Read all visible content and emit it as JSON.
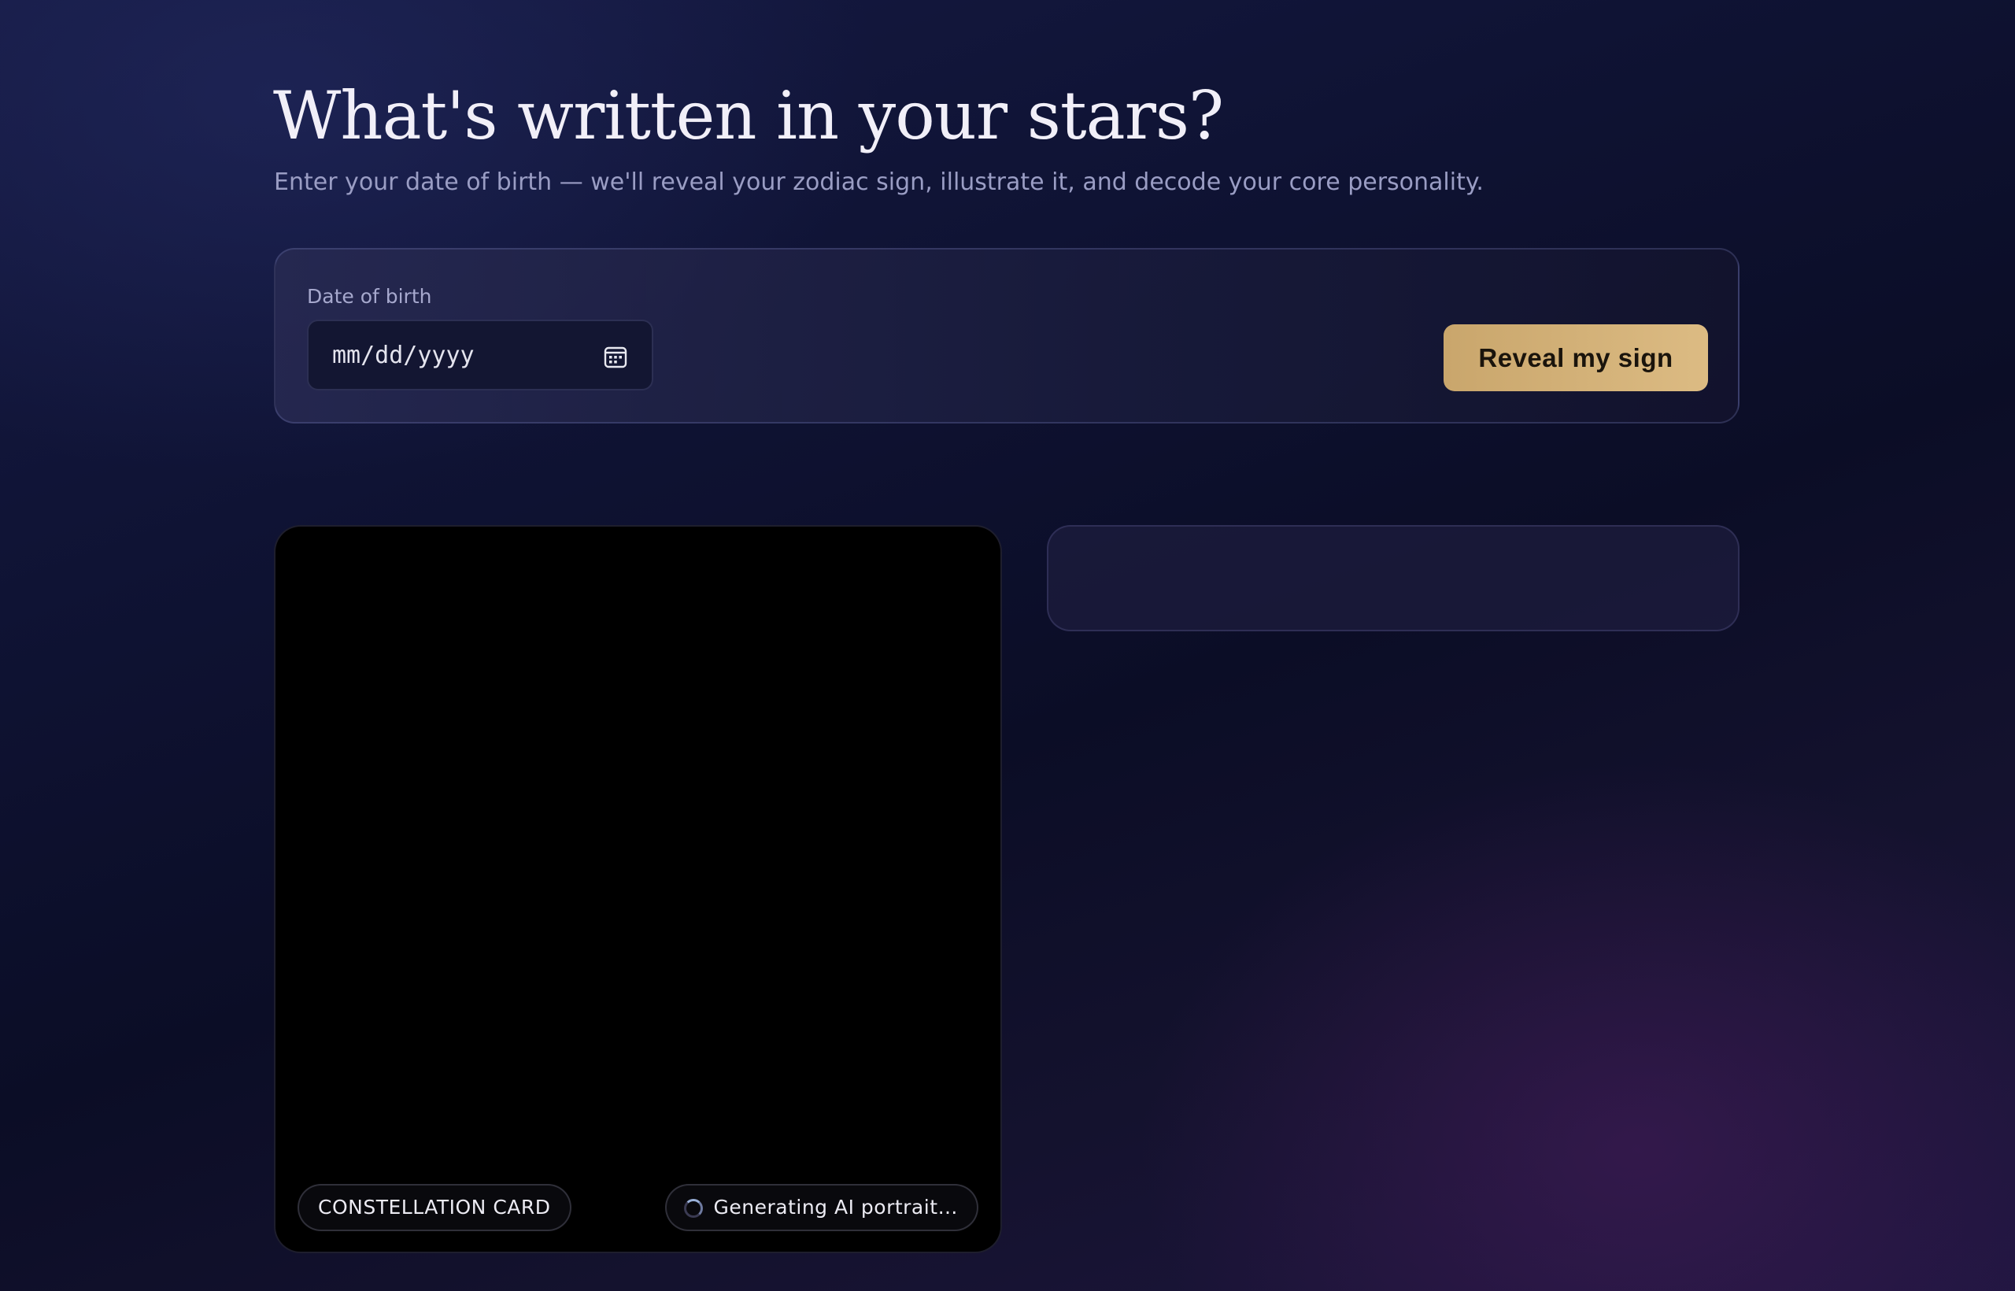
{
  "header": {
    "title": "What's written in your stars?",
    "subtitle": "Enter your date of birth — we'll reveal your zodiac sign, illustrate it, and decode your core personality."
  },
  "form": {
    "dob_label": "Date of birth",
    "dob_placeholder": "mm/dd/yyyy",
    "dob_value": "",
    "calendar_icon": "calendar-icon",
    "submit_label": "Reveal my sign"
  },
  "card": {
    "badge_label": "CONSTELLATION CARD",
    "status_text": "Generating AI portrait…",
    "status_icon": "spinner-icon"
  },
  "colors": {
    "accent_gold": "#d4b27a",
    "card_background": "#000000"
  }
}
